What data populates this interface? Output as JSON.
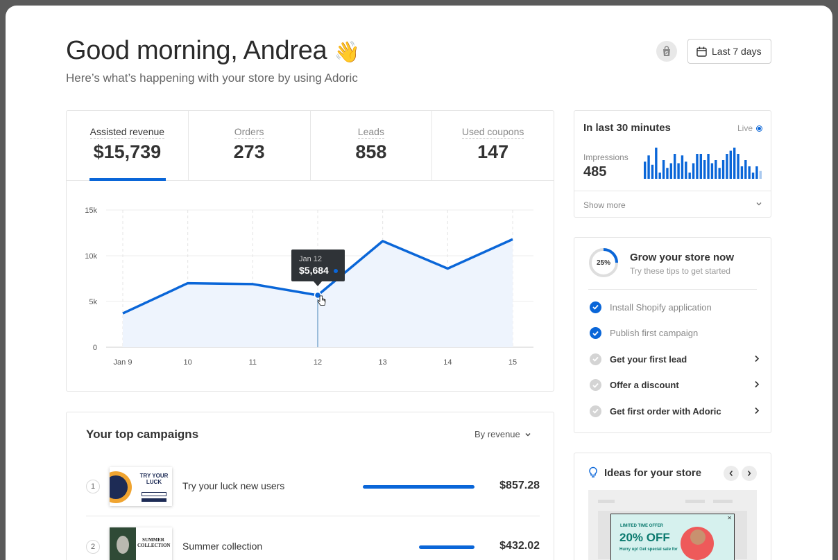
{
  "header": {
    "greeting": "Good morning, Andrea",
    "greeting_emoji": "👋",
    "subtitle": "Here’s what’s happening with your store by using Adoric",
    "date_range_label": "Last 7 days"
  },
  "metrics": [
    {
      "label": "Assisted revenue",
      "value": "$15,739",
      "active": true
    },
    {
      "label": "Orders",
      "value": "273",
      "active": false
    },
    {
      "label": "Leads",
      "value": "858",
      "active": false
    },
    {
      "label": "Used coupons",
      "value": "147",
      "active": false
    }
  ],
  "chart_data": {
    "type": "area",
    "categories": [
      "Jan 9",
      "10",
      "11",
      "12",
      "13",
      "14",
      "15"
    ],
    "values": [
      3700,
      7000,
      6900,
      5684,
      11600,
      8600,
      11800
    ],
    "ylim": [
      0,
      15000
    ],
    "yticks": [
      "0",
      "5k",
      "10k",
      "15k"
    ],
    "ytick_values": [
      0,
      5000,
      10000,
      15000
    ],
    "grid": true,
    "tooltip": {
      "index": 3,
      "date": "Jan 12",
      "value": "$5,684"
    },
    "colors": {
      "line": "#0a66d8",
      "fill": "#eef4fd",
      "tooltip": "#2f3337"
    }
  },
  "live": {
    "title": "In last 30 minutes",
    "live_label": "Live",
    "impressions_label": "Impressions",
    "impressions_value": "485",
    "show_more": "Show more",
    "bars": [
      0.55,
      0.75,
      0.45,
      1.0,
      0.2,
      0.6,
      0.35,
      0.5,
      0.8,
      0.5,
      0.75,
      0.55,
      0.2,
      0.5,
      0.8,
      0.8,
      0.6,
      0.8,
      0.5,
      0.6,
      0.35,
      0.6,
      0.8,
      0.9,
      1.0,
      0.8,
      0.4,
      0.6,
      0.4,
      0.2,
      0.4,
      0.25
    ]
  },
  "grow": {
    "progress_label": "25%",
    "progress": 0.25,
    "title": "Grow your store now",
    "subtitle": "Try these tips to get started",
    "tasks": [
      {
        "label": "Install Shopify application",
        "done": true
      },
      {
        "label": "Publish first campaign",
        "done": true
      },
      {
        "label": "Get your first lead",
        "done": false
      },
      {
        "label": "Offer a discount",
        "done": false
      },
      {
        "label": "Get first order with Adoric",
        "done": false
      }
    ]
  },
  "ideas": {
    "title": "Ideas for your store",
    "promo_small": "LIMITED TIME OFFER",
    "promo_big": "20% OFF",
    "promo_hurry": "Hurry up! Get special sale for"
  },
  "campaigns": {
    "title": "Your top campaigns",
    "sort_label": "By revenue",
    "items": [
      {
        "rank": "1",
        "name": "Try your luck new users",
        "amount": "$857.28",
        "share": 1.0,
        "thumb_text": "TRY YOUR LUCK"
      },
      {
        "rank": "2",
        "name": "Summer collection",
        "amount": "$432.02",
        "share": 0.5,
        "thumb_text": "SUMMER COLLECTION"
      }
    ]
  }
}
